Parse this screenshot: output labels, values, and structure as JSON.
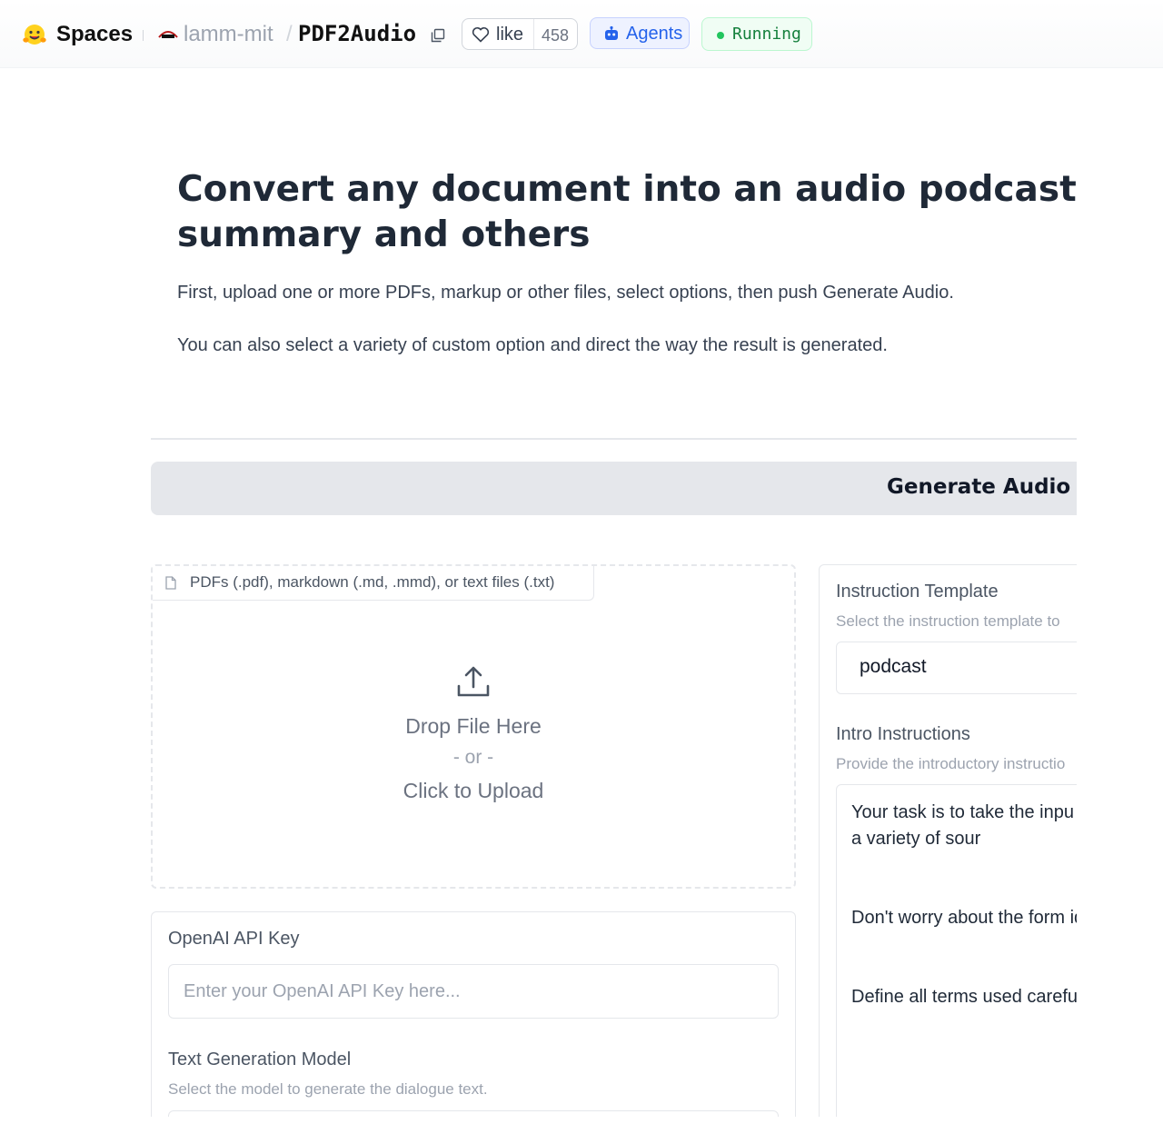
{
  "header": {
    "spaces_label": "Spaces",
    "org_name": "lamm-mit",
    "separator": "/",
    "space_name": "PDF2Audio",
    "like_label": "like",
    "like_count": "458",
    "agents_label": "Agents",
    "status_label": "Running",
    "icons": [
      "hugging-face-logo",
      "org-logo",
      "copy-icon",
      "heart-icon",
      "robot-icon",
      "status-dot"
    ]
  },
  "main": {
    "title": "Convert any document into an audio podcast, lecture, summary and others",
    "intro_line_1": "First, upload one or more PDFs, markup or other files, select options, then push Generate Audio.",
    "intro_line_2": "You can also select a variety of custom option and direct the way the result is generated.",
    "generate_button": "Generate Audio"
  },
  "upload": {
    "tab_label": "PDFs (.pdf), markdown (.md, .mmd), or text files (.txt)",
    "drop_text": "Drop File Here",
    "or_text": "- or -",
    "click_text": "Click to Upload"
  },
  "api_key": {
    "label": "OpenAI API Key",
    "placeholder": "Enter your OpenAI API Key here..."
  },
  "model": {
    "label": "Text Generation Model",
    "info": "Select the model to generate the dialogue text."
  },
  "instruction_template": {
    "label": "Instruction Template",
    "info": "Select the instruction template to",
    "value": "podcast"
  },
  "intro_instructions": {
    "label": "Intro Instructions",
    "info": "Provide the introductory instructio",
    "paragraph_1": "Your task is to take the inpu in the style of NPR. Do not come from a variety of sour",
    "paragraph_2": "Don't worry about the form identify definitions, and inte",
    "paragraph_3": "Define all terms used carefu"
  },
  "colors": {
    "accent_blue": "#2563eb",
    "status_green": "#22c55e",
    "button_gray": "#e5e7eb"
  }
}
